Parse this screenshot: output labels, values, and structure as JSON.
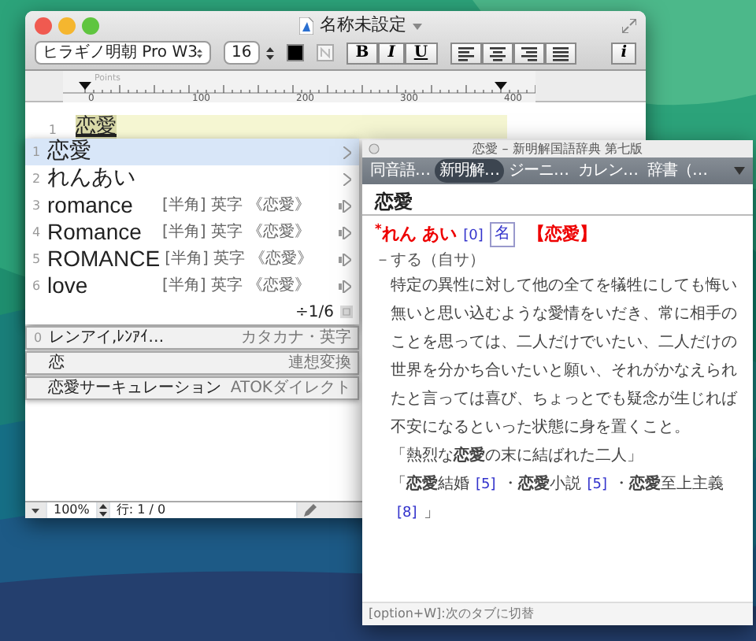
{
  "editor": {
    "title": "名称未設定",
    "font": "ヒラギノ明朝 Pro W3",
    "font_size": "16",
    "format_buttons": [
      "B",
      "I",
      "U"
    ],
    "info_button": "i",
    "ruler": {
      "unit": "Points",
      "ticks": [
        "0",
        "100",
        "200",
        "300",
        "400"
      ]
    },
    "lines": [
      {
        "number": "1",
        "text": "恋愛"
      }
    ],
    "status": {
      "zoom": "100%",
      "position": "行: 1 / 0"
    }
  },
  "candidates": {
    "items": [
      {
        "number": "1",
        "text": "恋愛",
        "selected": true,
        "kind": "submenu"
      },
      {
        "number": "2",
        "text": "れんあい",
        "selected": false,
        "kind": "submenu"
      },
      {
        "number": "3",
        "text": "romance",
        "selected": false,
        "kind": "english",
        "tags": [
          "[半角]",
          "英字",
          "《恋愛》"
        ]
      },
      {
        "number": "4",
        "text": "Romance",
        "selected": false,
        "kind": "english",
        "tags": [
          "[半角]",
          "英字",
          "《恋愛》"
        ]
      },
      {
        "number": "5",
        "text": "ROMANCE",
        "selected": false,
        "kind": "english",
        "tags": [
          "[半角]",
          "英字",
          "《恋愛》"
        ]
      },
      {
        "number": "6",
        "text": "love",
        "selected": false,
        "kind": "english",
        "tags": [
          "[半角]",
          "英字",
          "《恋愛》"
        ]
      }
    ],
    "pager": "÷1/6",
    "extras": [
      {
        "number": "0",
        "text": "レンアイ,ﾚﾝｱｲ…",
        "note": "カタカナ・英字"
      },
      {
        "text": "恋",
        "note": "連想変換"
      },
      {
        "text": "恋愛サーキュレーション",
        "note": "ATOKダイレクト"
      }
    ]
  },
  "dictionary": {
    "title": "恋愛 – 新明解国語辞典 第七版",
    "tabs": [
      {
        "label": "同音語…",
        "selected": false
      },
      {
        "label": "新明解…",
        "selected": true
      },
      {
        "label": "ジーニ…",
        "selected": false
      },
      {
        "label": "カレン…",
        "selected": false
      },
      {
        "label": "辞書（…",
        "selected": false
      }
    ],
    "headword": "恋愛",
    "entry": {
      "reading": "$^{*}$れん あい",
      "accent": "[0]",
      "pos": "名",
      "kanji": "【恋愛】",
      "grammar": "－する（自サ）",
      "definition": "特定の異性に対して他の全てを犠牲にしても悔い無いと思い込むような愛情をいだき、常に相手のことを思っては、二人だけでいたい、二人だけの世界を分かち合いたいと願い、それがかなえられたと言っては喜び、ちょっとでも疑念が生じれば不安になるといった状態に身を置くこと。",
      "examples": [
        "「熱烈な**恋愛**の末に結ばれた二人」"
      ],
      "compounds": [
        {
          "text": "「**恋愛**結婚",
          "ref": "[5]"
        },
        {
          "text": "・**恋愛**小説",
          "ref": "[5]"
        },
        {
          "text": "・**恋愛**至上主義",
          "ref": "[8]"
        }
      ],
      "compounds_close": "」"
    },
    "footer": "[option+W]:次のタブに切替"
  }
}
